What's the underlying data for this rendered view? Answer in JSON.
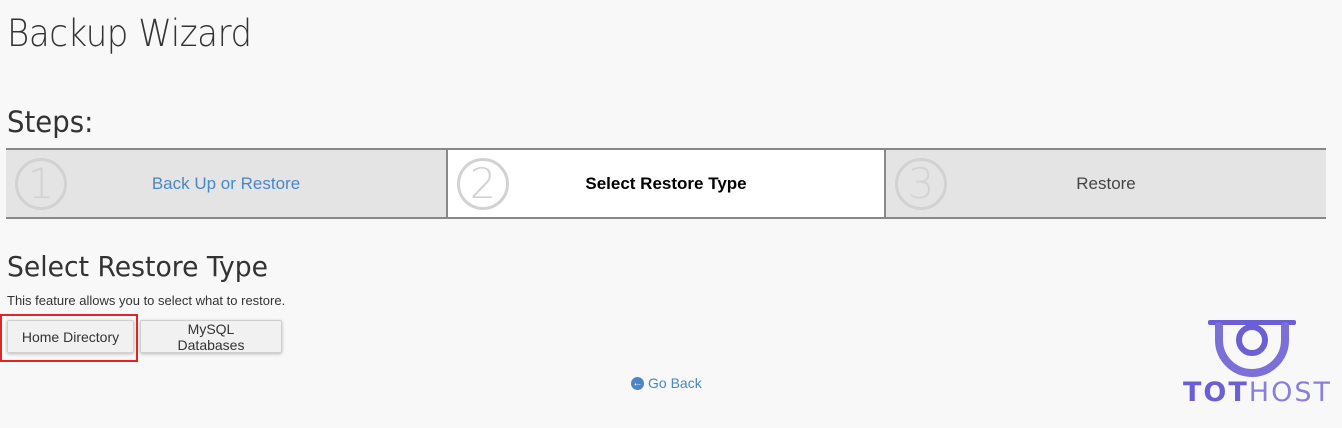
{
  "page": {
    "title": "Backup Wizard",
    "steps_heading": "Steps:"
  },
  "steps": [
    {
      "number": "1",
      "label": "Back Up or Restore",
      "state": "link"
    },
    {
      "number": "2",
      "label": "Select Restore Type",
      "state": "current"
    },
    {
      "number": "3",
      "label": "Restore",
      "state": "upcoming"
    }
  ],
  "section": {
    "title": "Select Restore Type",
    "description": "This feature allows you to select what to restore."
  },
  "buttons": {
    "home_directory": "Home Directory",
    "mysql_databases": "MySQL Databases"
  },
  "nav": {
    "go_back": "Go Back",
    "go_back_icon": "arrow-left-circle-icon"
  },
  "logo": {
    "part1": "TOT",
    "part2": "HOST"
  },
  "colors": {
    "link": "#4a86c8",
    "highlight": "#e0242b",
    "logo": "#6b5fd6"
  }
}
